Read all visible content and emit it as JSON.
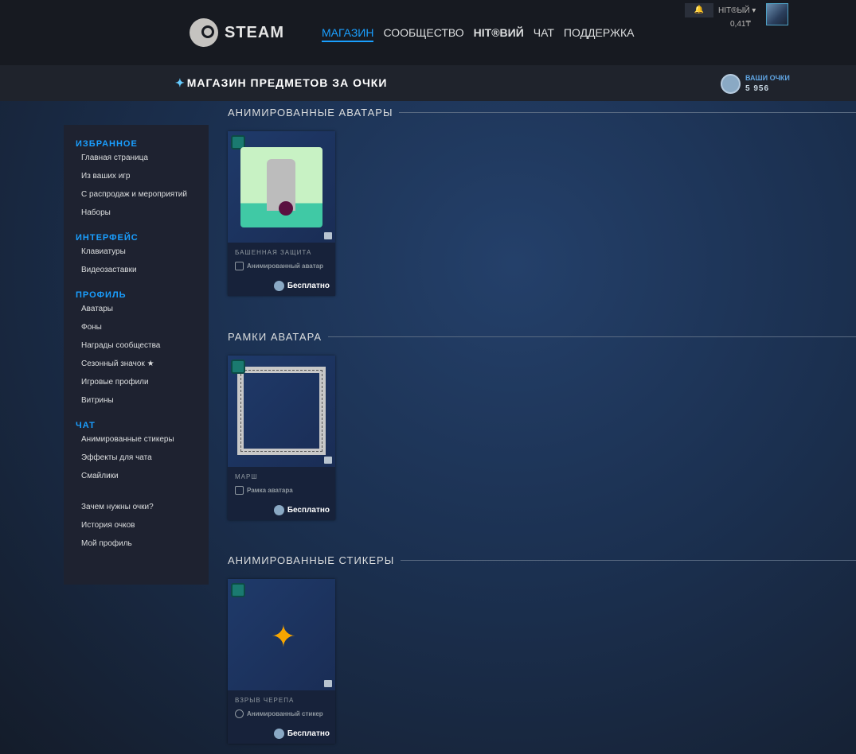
{
  "header": {
    "logo": "STEAM",
    "nav": [
      "МАГАЗИН",
      "СООБЩЕСТВО",
      "HIT®ВИЙ",
      "ЧАТ",
      "ПОДДЕРЖКА"
    ],
    "user": "HIT®ЫЙ ▾",
    "balance": "0,41₸",
    "bell": "🔔"
  },
  "subbar": {
    "title": "МАГАЗИН ПРЕДМЕТОВ ЗА ОЧКИ",
    "points_label": "ВАШИ ОЧКИ",
    "points_value": "5 956"
  },
  "sidebar": [
    {
      "title": "ИЗБРАННОЕ",
      "items": [
        "Главная страница",
        "Из ваших игр",
        "С распродаж и мероприятий",
        "Наборы"
      ]
    },
    {
      "title": "ИНТЕРФЕЙС",
      "items": [
        "Клавиатуры",
        "Видеозаставки"
      ]
    },
    {
      "title": "ПРОФИЛЬ",
      "items": [
        "Аватары",
        "Фоны",
        "Награды сообщества",
        "Сезонный значок ★",
        "Игровые профили",
        "Витрины"
      ]
    },
    {
      "title": "ЧАТ",
      "items": [
        "Анимированные стикеры",
        "Эффекты для чата",
        "Смайлики"
      ]
    },
    {
      "title": "",
      "items": [
        "Зачем нужны очки?",
        "История очков",
        "Мой профиль"
      ]
    }
  ],
  "sections": [
    {
      "title": "АНИМИРОВАННЫЕ АВАТАРЫ",
      "card": {
        "name": "БАШЕННАЯ ЗАЩИТА",
        "type": "Анимированный аватар",
        "price": "Бесплатно"
      }
    },
    {
      "title": "РАМКИ АВАТАРА",
      "card": {
        "name": "МАРШ",
        "type": "Рамка аватара",
        "price": "Бесплатно"
      }
    },
    {
      "title": "АНИМИРОВАННЫЕ СТИКЕРЫ",
      "card": {
        "name": "ВЗРЫВ ЧЕРЕПА",
        "type": "Анимированный стикер",
        "price": "Бесплатно"
      }
    }
  ]
}
